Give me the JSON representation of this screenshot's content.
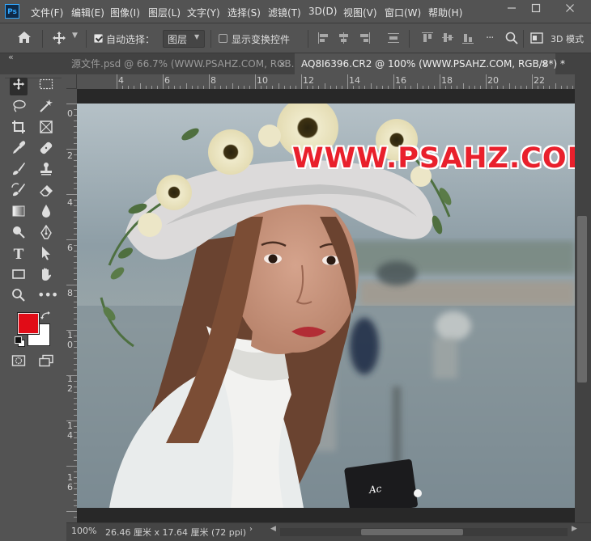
{
  "app": {
    "logo": "Ps"
  },
  "menu": [
    "文件(F)",
    "编辑(E)",
    "图像(I)",
    "图层(L)",
    "文字(Y)",
    "选择(S)",
    "滤镜(T)",
    "3D(D)",
    "视图(V)",
    "窗口(W)",
    "帮助(H)"
  ],
  "window_controls": [
    "minimize-icon",
    "maximize-icon",
    "close-icon"
  ],
  "options": {
    "auto_select_label": "自动选择：",
    "auto_select_checked": true,
    "auto_select_value": "图层",
    "show_transform_label": "显示变换控件",
    "show_transform_checked": false,
    "mode_3d_label": "3D 模式"
  },
  "tabs": [
    {
      "label": "源文件.psd @ 66.7% (WWW.PSAHZ.COM, RGB...",
      "active": false
    },
    {
      "label": "AQ8I6396.CR2 @ 100% (WWW.PSAHZ.COM, RGB/8*) *",
      "active": true
    }
  ],
  "panel_collapse": "«",
  "tools": [
    "move-icon",
    "marquee-icon",
    "lasso-icon",
    "magic-wand-icon",
    "crop-icon",
    "frame-icon",
    "eyedropper-icon",
    "healing-icon",
    "brush-icon",
    "stamp-icon",
    "history-brush-icon",
    "eraser-icon",
    "gradient-icon",
    "blur-icon",
    "dodge-icon",
    "pen-icon",
    "type-icon",
    "path-select-icon",
    "rectangle-icon",
    "hand-icon",
    "zoom-icon",
    "more-icon",
    "foreground-color-icon",
    "background-color-icon",
    "swap-colors-icon",
    "default-colors-icon",
    "quick-mask-icon",
    "screen-mode-icon"
  ],
  "colors": {
    "foreground": "#e10c17",
    "background": "#ffffff",
    "watermark": "#e9202c",
    "accent": "#31a8ff"
  },
  "ruler_top": [
    "4",
    "6",
    "8",
    "10",
    "12",
    "14",
    "16",
    "18",
    "20",
    "22"
  ],
  "ruler_left": [
    "0",
    "2",
    "4",
    "6",
    "8",
    "1",
    "0",
    "1",
    "2",
    "1",
    "4",
    "1",
    "6"
  ],
  "canvas": {
    "watermark_text": "WWW.PSAHZ.COM"
  },
  "status": {
    "zoom": "100%",
    "doc_info": "26.46 厘米 x 17.64 厘米 (72 ppi)"
  }
}
